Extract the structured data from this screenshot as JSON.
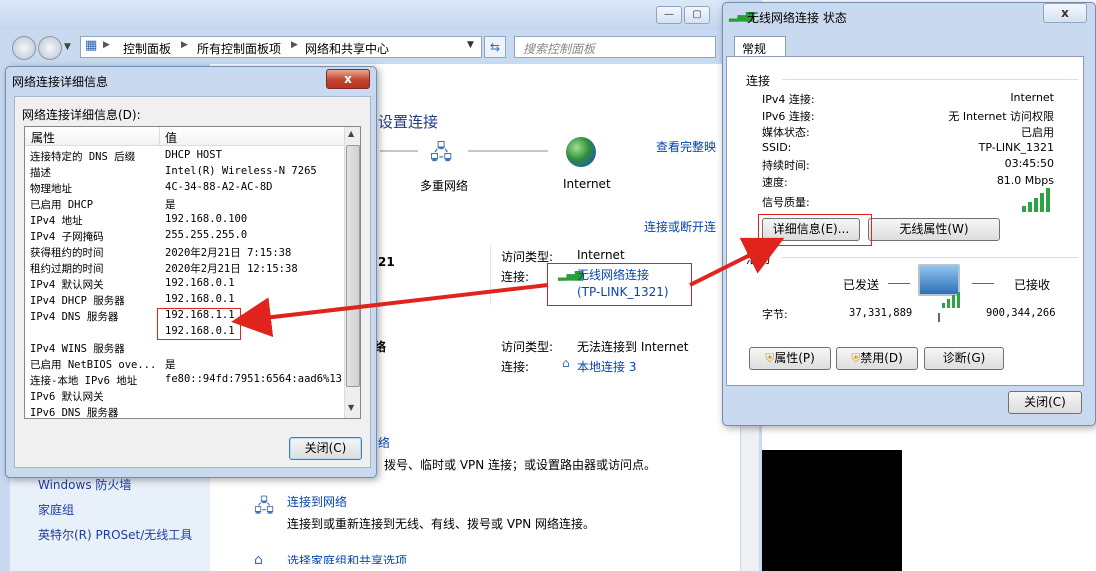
{
  "background": {
    "breadcrumb": [
      "控制面板",
      "所有控制面板项",
      "网络和共享中心"
    ],
    "search_placeholder": "搜索控制面板",
    "setup_title": "设置连接",
    "view_full_map": "查看完整映",
    "connect_disconnect": "连接或断开连",
    "multi_network": "多重网络",
    "internet": "Internet",
    "net1": {
      "name": "21",
      "access_type_label": "访问类型:",
      "access_type_value": "Internet",
      "conn_label": "连接:",
      "conn_value": "无线网络连接\n(TP-LINK_1321)"
    },
    "net2": {
      "name": "络",
      "access_type_label": "访问类型:",
      "access_type_value": "无法连接到 Internet",
      "conn_label": "连接:",
      "conn_value": "本地连接 3"
    },
    "setup_link_frag": "络",
    "setup_desc": "拨号、临时或 VPN 连接；或设置路由器或访问点。",
    "connect_to_network": "连接到网络",
    "connect_to_network_desc": "连接到或重新连接到无线、有线、拨号或 VPN 网络连接。",
    "homegroup_options": "选择家庭组和共享选项",
    "sidebar": [
      "Windows 防火墙",
      "家庭组",
      "英特尔(R) PROSet/无线工具"
    ]
  },
  "details_dialog": {
    "title": "网络连接详细信息",
    "list_label": "网络连接详细信息(D):",
    "col_property": "属性",
    "col_value": "值",
    "rows": [
      {
        "name": "连接特定的 DNS 后缀",
        "value": "DHCP HOST"
      },
      {
        "name": "描述",
        "value": "Intel(R) Wireless-N 7265"
      },
      {
        "name": "物理地址",
        "value": "4C-34-88-A2-AC-8D"
      },
      {
        "name": "已启用 DHCP",
        "value": "是"
      },
      {
        "name": "IPv4 地址",
        "value": "192.168.0.100"
      },
      {
        "name": "IPv4 子网掩码",
        "value": "255.255.255.0"
      },
      {
        "name": "获得租约的时间",
        "value": "2020年2月21日 7:15:38"
      },
      {
        "name": "租约过期的时间",
        "value": "2020年2月21日 12:15:38"
      },
      {
        "name": "IPv4 默认网关",
        "value": "192.168.0.1"
      },
      {
        "name": "IPv4 DHCP 服务器",
        "value": "192.168.0.1"
      },
      {
        "name": "IPv4 DNS 服务器",
        "value": "192.168.1.1"
      },
      {
        "name": "",
        "value": "192.168.0.1"
      },
      {
        "name": "IPv4 WINS 服务器",
        "value": ""
      },
      {
        "name": "已启用 NetBIOS ove...",
        "value": "是"
      },
      {
        "name": "连接-本地 IPv6 地址",
        "value": "fe80::94fd:7951:6564:aad6%13"
      },
      {
        "name": "IPv6 默认网关",
        "value": ""
      },
      {
        "name": "IPv6 DNS 服务器",
        "value": ""
      }
    ],
    "close_button": "关闭(C)",
    "close_x": "x"
  },
  "status_dialog": {
    "title": "无线网络连接 状态",
    "tab": "常规",
    "section_connection": "连接",
    "fields": [
      {
        "label": "IPv4 连接:",
        "value": "Internet"
      },
      {
        "label": "IPv6 连接:",
        "value": "无 Internet 访问权限"
      },
      {
        "label": "媒体状态:",
        "value": "已启用"
      },
      {
        "label": "SSID:",
        "value": "TP-LINK_1321"
      },
      {
        "label": "持续时间:",
        "value": "03:45:50"
      },
      {
        "label": "速度:",
        "value": "81.0 Mbps"
      }
    ],
    "signal_label": "信号质量:",
    "details_button": "详细信息(E)...",
    "wireless_props_button": "无线属性(W)",
    "section_activity": "活动",
    "sent_label": "已发送",
    "received_label": "已接收",
    "bytes_label": "字节:",
    "bytes_sent": "37,331,889",
    "bytes_received": "900,344,266",
    "props_button": "属性(P)",
    "disable_button": "禁用(D)",
    "diagnose_button": "诊断(G)",
    "close_button": "关闭(C)"
  }
}
